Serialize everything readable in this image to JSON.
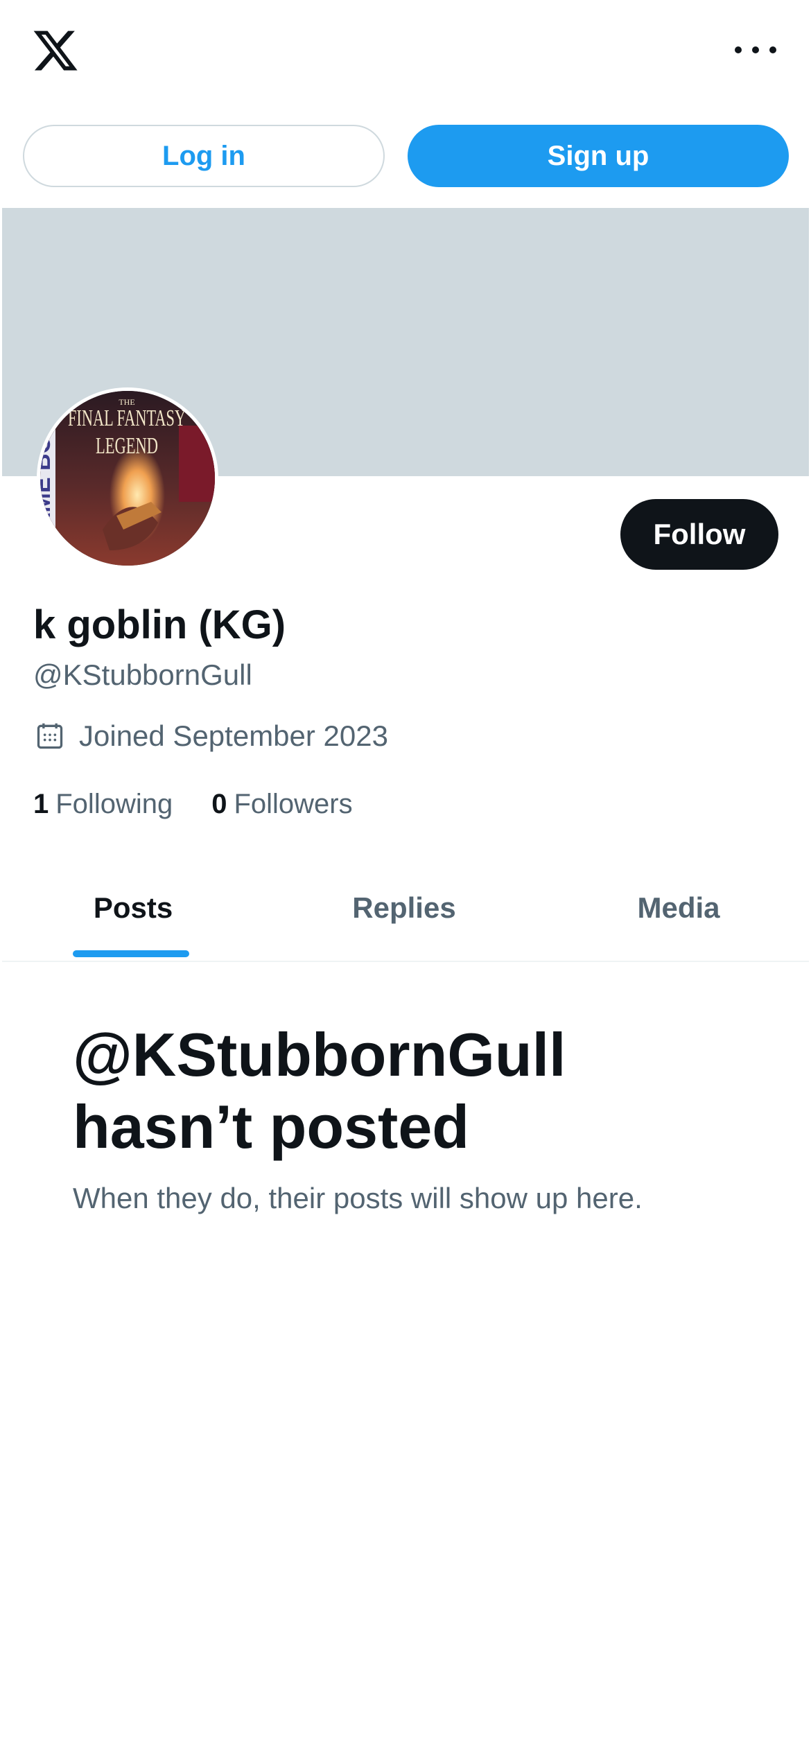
{
  "header": {
    "logo_icon": "x-logo-icon",
    "more_icon": "more-horizontal-icon"
  },
  "auth": {
    "login_label": "Log in",
    "signup_label": "Sign up"
  },
  "colors": {
    "accent": "#1d9bf0",
    "banner": "#cfd9de",
    "text_primary": "#0f1419",
    "text_secondary": "#536471"
  },
  "profile": {
    "display_name": "k goblin (KG)",
    "handle": "@KStubbornGull",
    "joined": "Joined September 2023",
    "follow_label": "Follow",
    "following_count": "1",
    "following_label": "Following",
    "followers_count": "0",
    "followers_label": "Followers",
    "avatar_text": {
      "line1": "THE",
      "line2": "FINAL FANTASY",
      "line3": "LEGEND",
      "side": "AME BO"
    }
  },
  "tabs": [
    {
      "label": "Posts",
      "active": true
    },
    {
      "label": "Replies",
      "active": false
    },
    {
      "label": "Media",
      "active": false
    }
  ],
  "empty_state": {
    "title_line1": "@KStubbornGull",
    "title_line2": "hasn’t posted",
    "subtitle": "When they do, their posts will show up here."
  }
}
